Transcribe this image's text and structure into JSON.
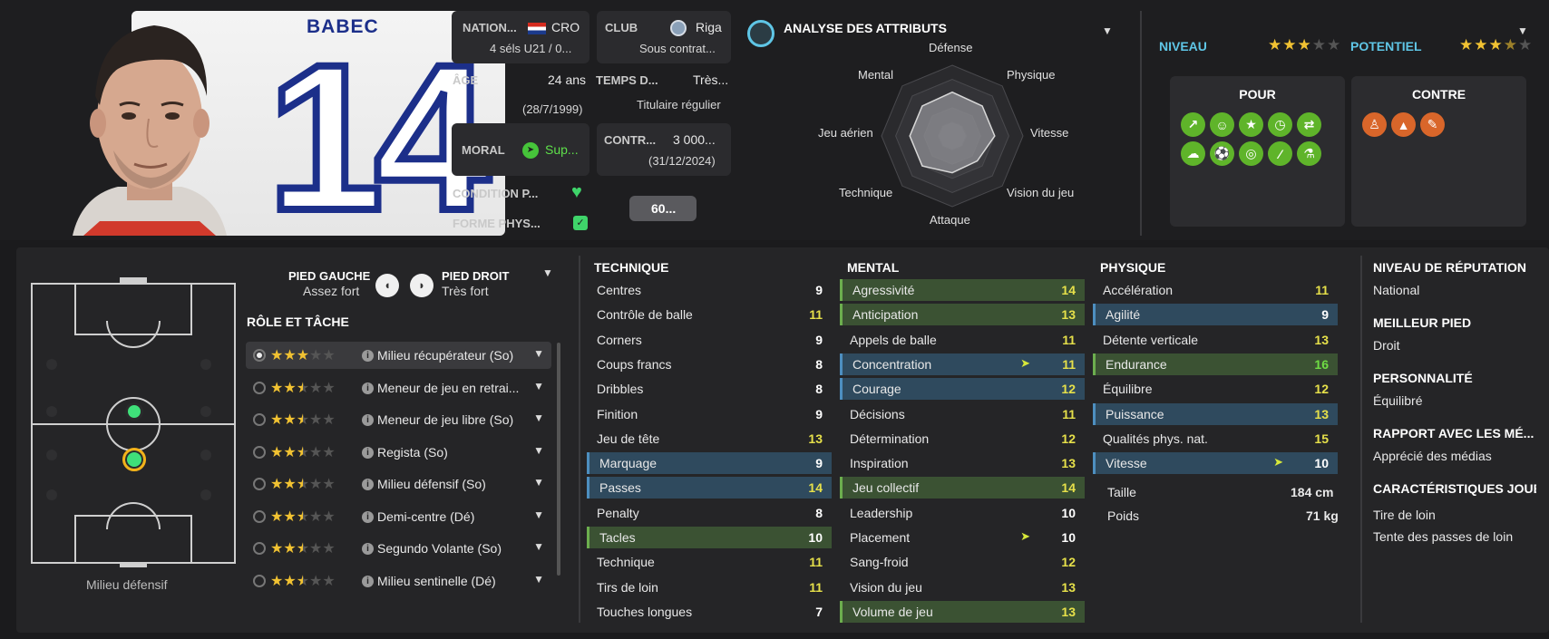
{
  "player": {
    "shirt_name": "BABEC",
    "shirt_number": "14"
  },
  "info": {
    "nation_label": "NATION...",
    "nation_value": "CRO",
    "nation_sub": "4 séls U21 / 0...",
    "club_label": "CLUB",
    "club_value": "Riga",
    "club_sub": "Sous contrat...",
    "age_label": "ÂGE",
    "age_value": "24 ans",
    "age_sub": "(28/7/1999)",
    "playtime_label": "TEMPS D...",
    "playtime_value": "Très...",
    "playtime_sub": "Titulaire régulier",
    "morale_label": "MORAL",
    "morale_value": "Sup...",
    "contract_label": "CONTR...",
    "contract_value": "3 000...",
    "contract_sub": "(31/12/2024)",
    "condition_label": "CONDITION P...",
    "fitness_label": "FORME PHYS...",
    "fitness_pill": "60..."
  },
  "radar": {
    "title": "ANALYSE DES ATTRIBUTS",
    "labels": {
      "defense": "Défense",
      "physique": "Physique",
      "vitesse": "Vitesse",
      "vision": "Vision du jeu",
      "attaque": "Attaque",
      "technique": "Technique",
      "aerien": "Jeu aérien",
      "mental": "Mental"
    },
    "values_out_of_1": [
      0.62,
      0.6,
      0.6,
      0.5,
      0.52,
      0.6,
      0.6,
      0.6
    ]
  },
  "rating": {
    "niveau_label": "NIVEAU",
    "niveau_stars": 3,
    "potentiel_label": "POTENTIEL",
    "potentiel_stars": 3.5
  },
  "pros_cons": {
    "pour_title": "POUR",
    "contre_title": "CONTRE",
    "pour_icons": [
      "trend-up-icon",
      "face-icon",
      "star-icon",
      "stopwatch-icon",
      "handshake-icon",
      "brain-icon",
      "ball-icon",
      "target-icon",
      "boot-icon",
      "flask-icon"
    ],
    "contre_icons": [
      "person-icon",
      "cone-icon",
      "clipboard-icon"
    ]
  },
  "feet": {
    "left_label": "PIED GAUCHE",
    "left_value": "Assez fort",
    "right_label": "PIED DROIT",
    "right_value": "Très fort"
  },
  "position_label": "Milieu défensif",
  "roles_title": "RÔLE ET TÂCHE",
  "roles": [
    {
      "name": "Milieu récupérateur (So)",
      "stars": 3
    },
    {
      "name": "Meneur de jeu en retrai...",
      "stars": 2.5
    },
    {
      "name": "Meneur de jeu libre (So)",
      "stars": 2.5
    },
    {
      "name": "Regista (So)",
      "stars": 2.5
    },
    {
      "name": "Milieu défensif (So)",
      "stars": 2.5
    },
    {
      "name": "Demi-centre (Dé)",
      "stars": 2.5
    },
    {
      "name": "Segundo Volante (So)",
      "stars": 2.5
    },
    {
      "name": "Milieu sentinelle (Dé)",
      "stars": 2.5
    }
  ],
  "technique": {
    "title": "TECHNIQUE",
    "items": [
      {
        "name": "Centres",
        "value": "9"
      },
      {
        "name": "Contrôle de balle",
        "value": "11"
      },
      {
        "name": "Corners",
        "value": "9"
      },
      {
        "name": "Coups francs",
        "value": "8"
      },
      {
        "name": "Dribbles",
        "value": "8"
      },
      {
        "name": "Finition",
        "value": "9"
      },
      {
        "name": "Jeu de tête",
        "value": "13"
      },
      {
        "name": "Marquage",
        "value": "9"
      },
      {
        "name": "Passes",
        "value": "14"
      },
      {
        "name": "Penalty",
        "value": "8"
      },
      {
        "name": "Tacles",
        "value": "10"
      },
      {
        "name": "Technique",
        "value": "11"
      },
      {
        "name": "Tirs de loin",
        "value": "11"
      },
      {
        "name": "Touches longues",
        "value": "7"
      }
    ]
  },
  "mental": {
    "title": "MENTAL",
    "items": [
      {
        "name": "Agressivité",
        "value": "14"
      },
      {
        "name": "Anticipation",
        "value": "13"
      },
      {
        "name": "Appels de balle",
        "value": "11"
      },
      {
        "name": "Concentration",
        "value": "11"
      },
      {
        "name": "Courage",
        "value": "12"
      },
      {
        "name": "Décisions",
        "value": "11"
      },
      {
        "name": "Détermination",
        "value": "12"
      },
      {
        "name": "Inspiration",
        "value": "13"
      },
      {
        "name": "Jeu collectif",
        "value": "14"
      },
      {
        "name": "Leadership",
        "value": "10"
      },
      {
        "name": "Placement",
        "value": "10"
      },
      {
        "name": "Sang-froid",
        "value": "12"
      },
      {
        "name": "Vision du jeu",
        "value": "13"
      },
      {
        "name": "Volume de jeu",
        "value": "13"
      }
    ]
  },
  "physique": {
    "title": "PHYSIQUE",
    "items": [
      {
        "name": "Accélération",
        "value": "11"
      },
      {
        "name": "Agilité",
        "value": "9"
      },
      {
        "name": "Détente verticale",
        "value": "13"
      },
      {
        "name": "Endurance",
        "value": "16"
      },
      {
        "name": "Équilibre",
        "value": "12"
      },
      {
        "name": "Puissance",
        "value": "13"
      },
      {
        "name": "Qualités phys. nat.",
        "value": "15"
      },
      {
        "name": "Vitesse",
        "value": "10"
      }
    ],
    "height_label": "Taille",
    "height_value": "184 cm",
    "weight_label": "Poids",
    "weight_value": "71 kg"
  },
  "side_info": {
    "reputation_title": "NIVEAU DE RÉPUTATION",
    "reputation_value": "National",
    "best_foot_title": "MEILLEUR PIED",
    "best_foot_value": "Droit",
    "personality_title": "PERSONNALITÉ",
    "personality_value": "Équilibré",
    "media_title": "RAPPORT AVEC LES MÉ...",
    "media_value": "Apprécié des médias",
    "traits_title": "CARACTÉRISTIQUES JOUEUR",
    "traits": [
      "Tire de loin",
      "Tente des passes de loin"
    ]
  },
  "colors": {
    "accent_blue": "#5fc6e6",
    "star_gold": "#f1c232",
    "pro_green": "#5fb42a",
    "con_orange": "#d9662a",
    "highlight_blue": "#2f4a5e",
    "highlight_green": "#3b5233"
  }
}
